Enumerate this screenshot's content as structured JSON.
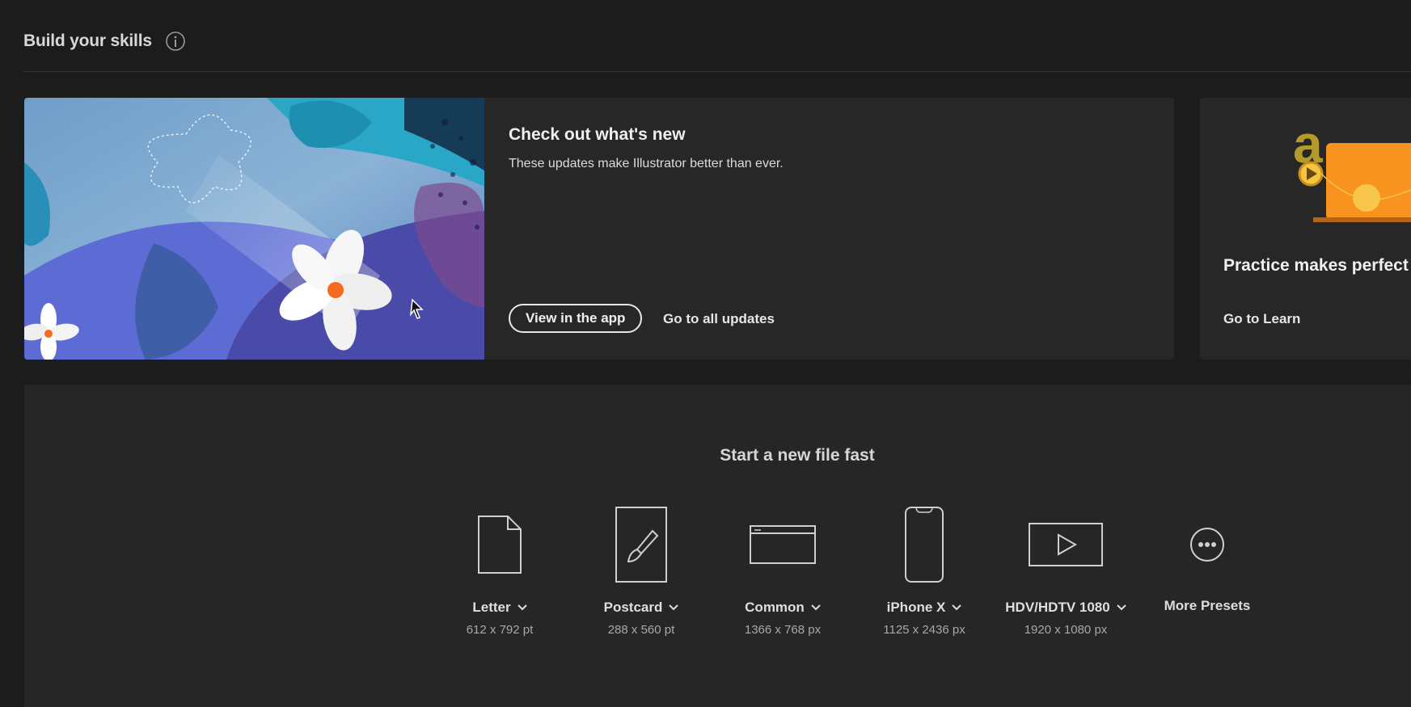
{
  "header": {
    "title": "Build your skills"
  },
  "whats_new": {
    "title": "Check out what's new",
    "description": "These updates make Illustrator better than ever.",
    "primary_button": "View in the app",
    "secondary_link": "Go to all updates"
  },
  "practice": {
    "title": "Practice makes perfect",
    "link": "Go to Learn"
  },
  "new_file": {
    "title": "Start a new file fast",
    "presets": [
      {
        "label": "Letter",
        "size": "612 x 792 pt",
        "icon": "document-icon"
      },
      {
        "label": "Postcard",
        "size": "288 x 560 pt",
        "icon": "brush-icon"
      },
      {
        "label": "Common",
        "size": "1366 x 768 px",
        "icon": "browser-window-icon"
      },
      {
        "label": "iPhone X",
        "size": "1125 x 2436 px",
        "icon": "phone-icon"
      },
      {
        "label": "HDV/HDTV 1080",
        "size": "1920 x 1080 px",
        "icon": "video-play-icon"
      },
      {
        "label": "More Presets",
        "icon": "more-icon"
      }
    ]
  },
  "colors": {
    "background": "#1c1c1c",
    "card": "#272727",
    "accent_orange": "#f7931e",
    "illustration_blue": "#5a6fd6"
  }
}
